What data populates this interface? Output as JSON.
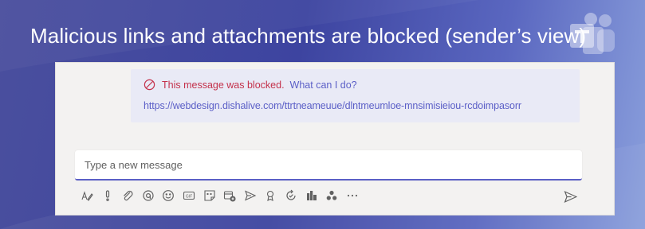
{
  "slide": {
    "title": "Malicious links and attachments are blocked (sender’s view)",
    "logo_icon": "teams-logo-icon",
    "colors": {
      "background": "#3d44a0",
      "accent": "#5b5fc7",
      "blocked_red": "#c4314b",
      "card_bg": "#e9eaf6",
      "panel_bg": "#f3f2f1"
    }
  },
  "message": {
    "status_icon": "blocked-circle-icon",
    "blocked_text": "This message was blocked.",
    "help_link": "What can I do?",
    "url": "https://webdesign.dishalive.com/ttrtneameuue/dlntmeumloe-mnsimisieiou-rcdoimpasorr"
  },
  "compose": {
    "placeholder": "Type a new message",
    "value": ""
  },
  "toolbar": {
    "icons": [
      "format-icon",
      "priority-icon",
      "attach-icon",
      "loop-icon",
      "emoji-icon",
      "gif-icon",
      "sticker-icon",
      "meet-now-icon",
      "schedule-send-icon",
      "praise-icon",
      "approvals-icon",
      "stream-icon",
      "viva-icon",
      "more-icon"
    ],
    "send_icon": "send-icon"
  }
}
